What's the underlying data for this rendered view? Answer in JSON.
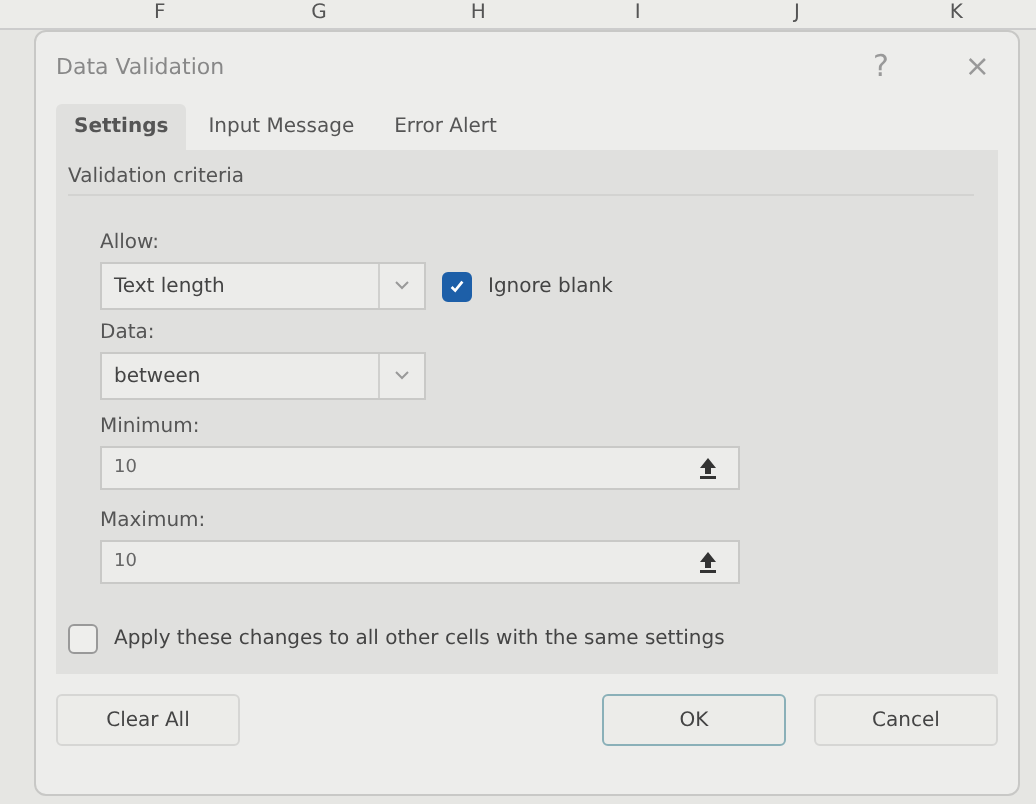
{
  "sheet": {
    "column_headers": [
      "F",
      "G",
      "H",
      "I",
      "J",
      "K"
    ]
  },
  "window": {
    "title": "Data Validation",
    "help": "?",
    "close": "×"
  },
  "tabs": [
    {
      "label": "Settings",
      "selected": true
    },
    {
      "label": "Input Message",
      "selected": false
    },
    {
      "label": "Error Alert",
      "selected": false
    }
  ],
  "criteria": {
    "heading": "Validation criteria",
    "allow": {
      "label": "Allow:",
      "value": "Text length"
    },
    "ignore_blank": {
      "label": "Ignore blank",
      "checked": true
    },
    "data": {
      "label": "Data:",
      "value": "between"
    },
    "minimum": {
      "label": "Minimum:",
      "value": "10"
    },
    "maximum": {
      "label": "Maximum:",
      "value": "10"
    }
  },
  "apply_all": {
    "label": "Apply these changes to all other cells with the same settings",
    "checked": false
  },
  "buttons": [
    {
      "label": "Clear All",
      "kind": "left"
    },
    {
      "label": "OK",
      "kind": "default"
    },
    {
      "label": "Cancel",
      "kind": "plain"
    }
  ]
}
